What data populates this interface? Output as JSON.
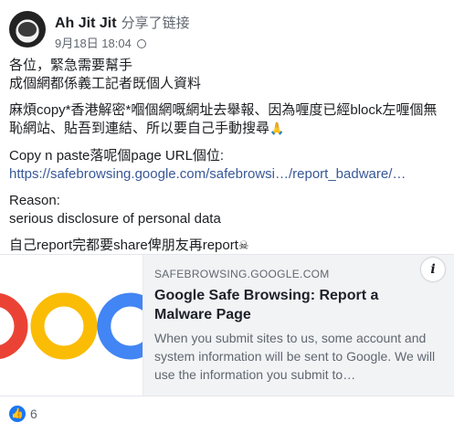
{
  "post": {
    "author": "Ah Jit Jit",
    "action": "分享了链接",
    "timestamp": "9月18日 18:04",
    "lines": {
      "l1": "各位，緊急需要幫手",
      "l2": "成個網都係義工記者既個人資料",
      "l3": "麻煩copy*香港解密*嗰個網嘅網址去舉報、因為喱度已經block左喱個無",
      "l4": "恥網站、貼吾到連結、所以要自己手動搜尋",
      "l4_emoji": "🙏",
      "l5": "Copy n paste落呢個page URL個位:",
      "l6_link": "https://safebrowsing.google.com/safebrowsi…/report_badware/…",
      "l7": "Reason:",
      "l8": "serious disclosure of personal data",
      "l9": "自己report完都要share俾朋友再report",
      "l9_emoji": "☠"
    }
  },
  "link_card": {
    "domain": "SAFEBROWSING.GOOGLE.COM",
    "title": "Google Safe Browsing: Report a Malware Page",
    "description": "When you submit sites to us, some account and system information will be sent to Google. We will use the information you submit to…",
    "info_symbol": "i",
    "image_icon": "google-logo-partial"
  },
  "reactions": {
    "icon": "like-icon",
    "symbol": "👍",
    "count": "6"
  },
  "colors": {
    "link": "#385898",
    "accent": "#1877f2",
    "google_blue": "#4285f4",
    "google_red": "#ea4335",
    "google_yellow": "#fbbc05",
    "google_green": "#34a853"
  }
}
